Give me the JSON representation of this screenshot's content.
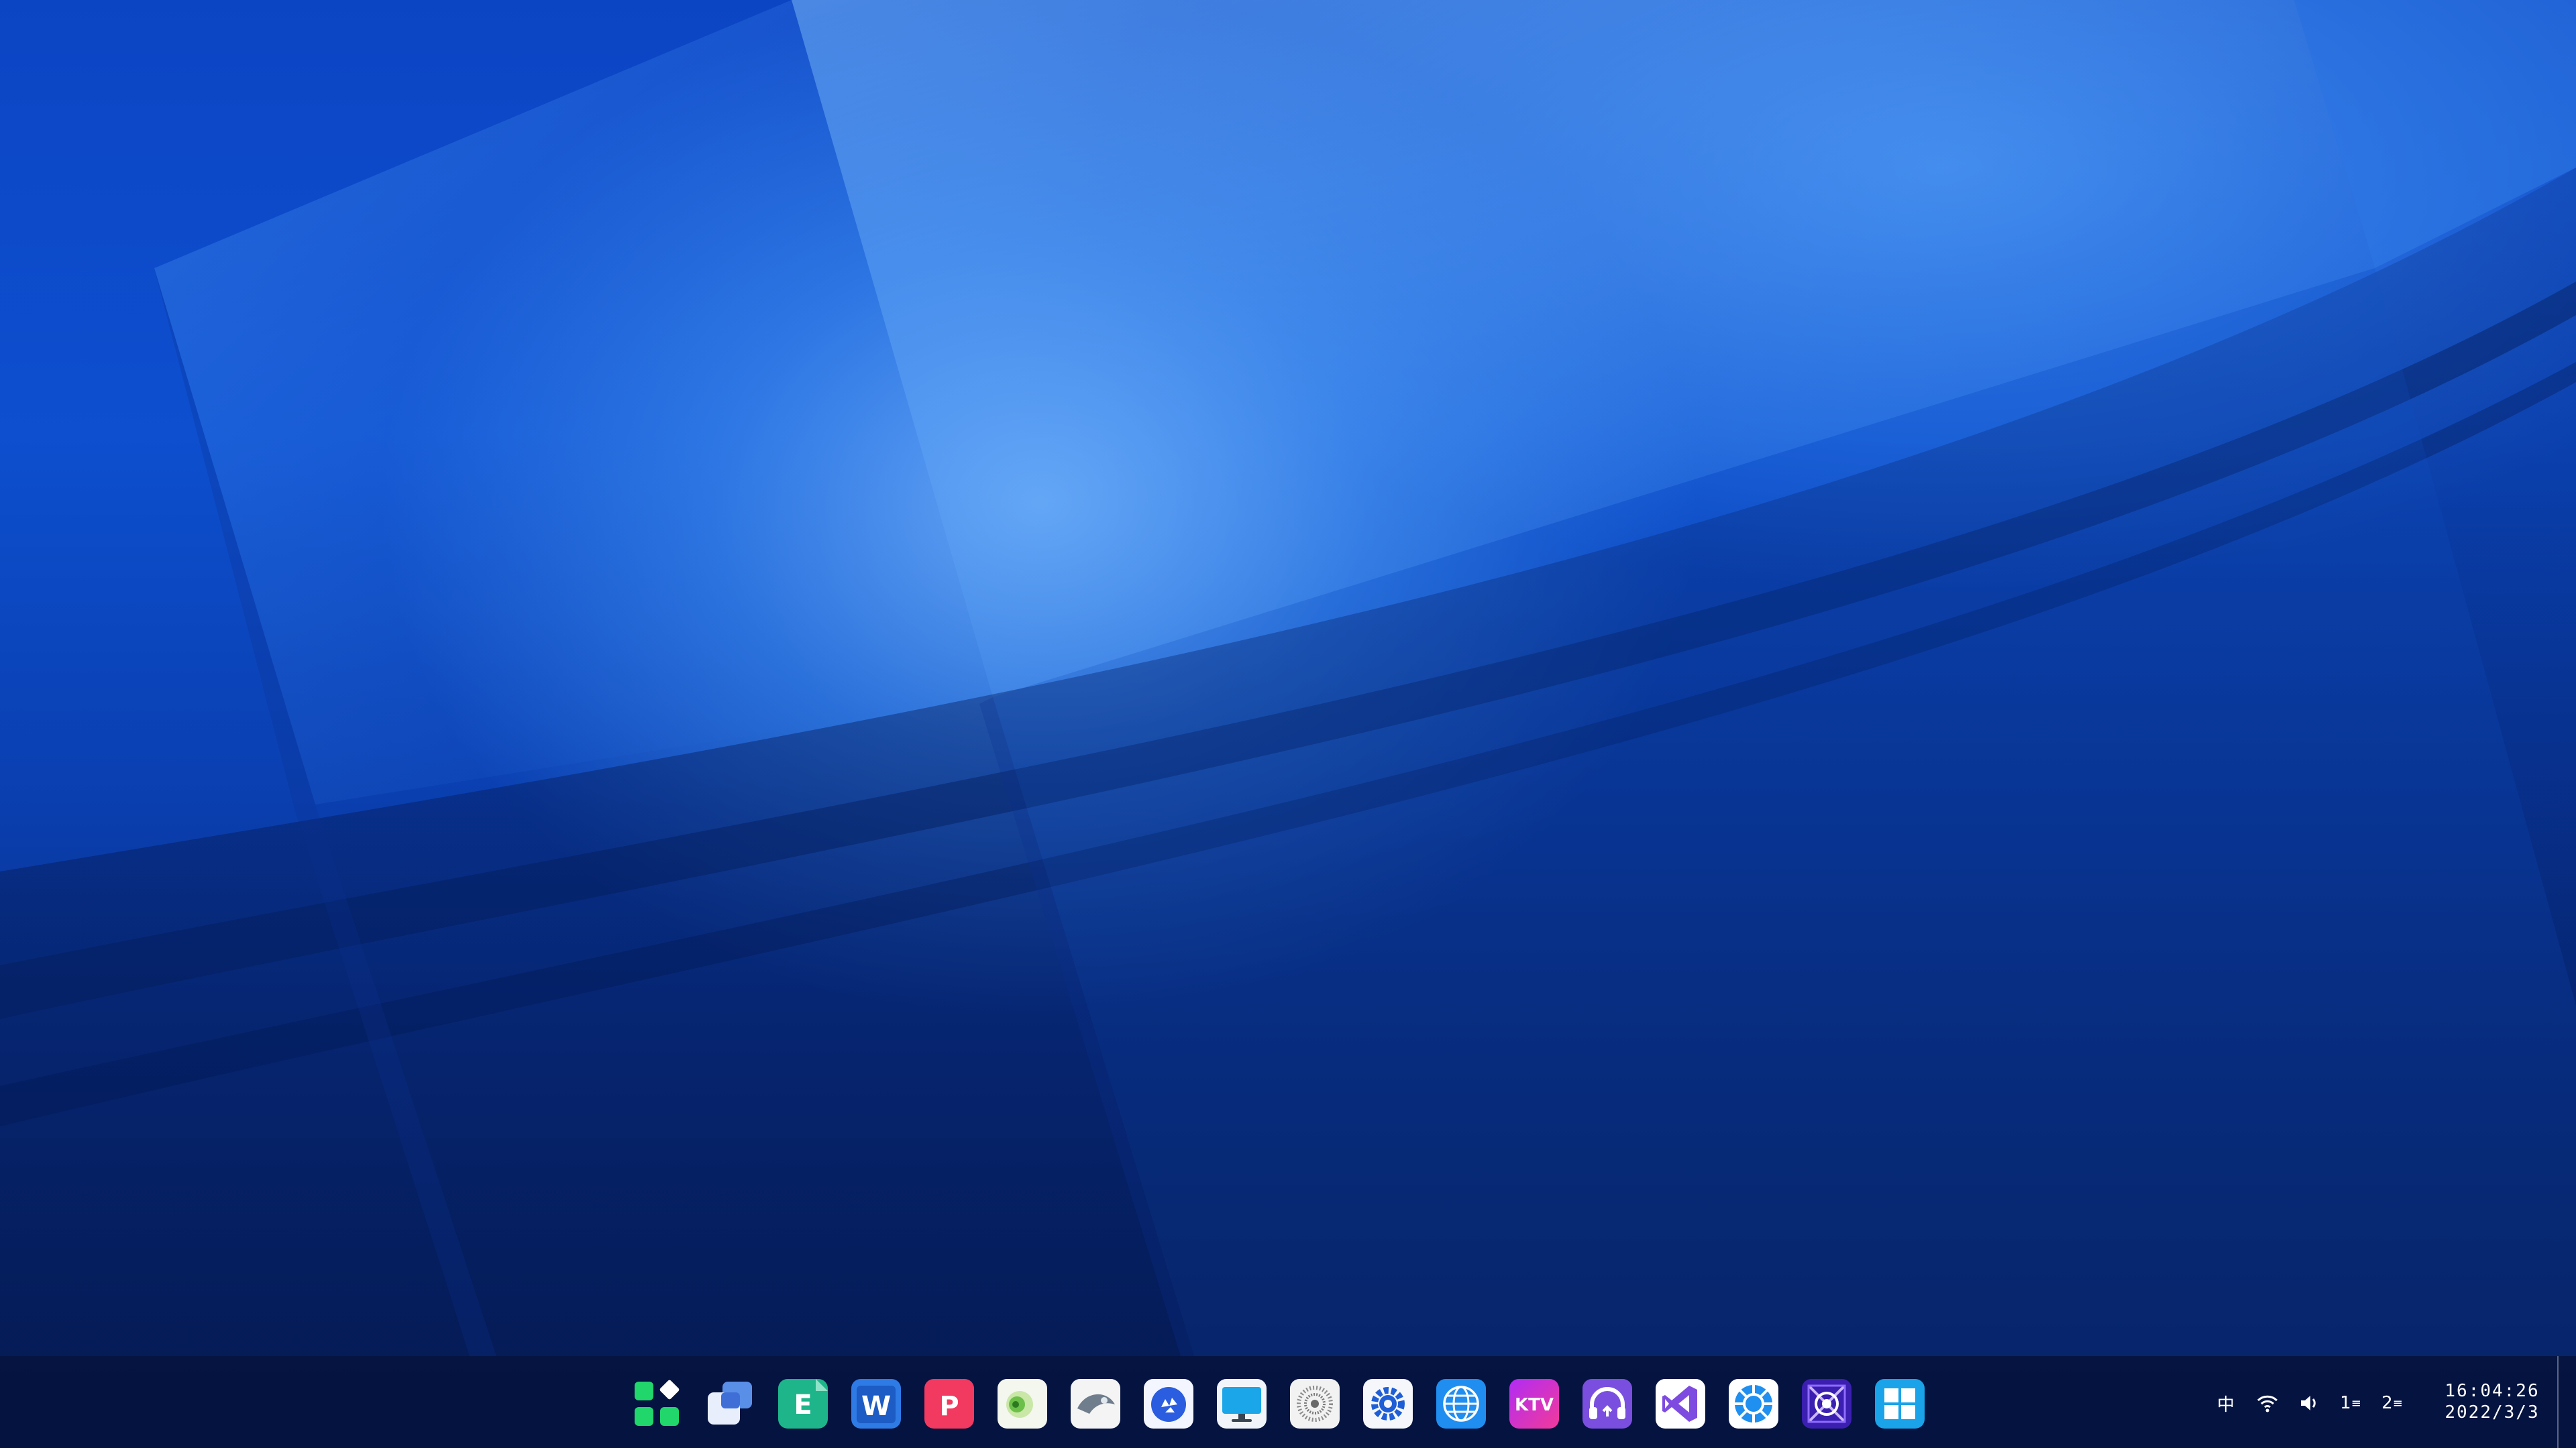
{
  "taskbar": {
    "apps": [
      {
        "name": "launcher",
        "icon": "launcher-icon"
      },
      {
        "name": "multitasking-view",
        "icon": "multitask-icon"
      },
      {
        "name": "spreadsheet",
        "icon": "spreadsheet-icon",
        "label": "E"
      },
      {
        "name": "word-processor",
        "icon": "word-icon",
        "label": "W"
      },
      {
        "name": "presentation",
        "icon": "presentation-icon",
        "label": "P"
      },
      {
        "name": "music-player",
        "icon": "music-icon"
      },
      {
        "name": "image-viewer",
        "icon": "image-viewer-icon"
      },
      {
        "name": "recycle-bin",
        "icon": "recycle-icon"
      },
      {
        "name": "remote-desktop",
        "icon": "monitor-icon"
      },
      {
        "name": "system-monitor",
        "icon": "sunburst-icon"
      },
      {
        "name": "settings",
        "icon": "gear-icon"
      },
      {
        "name": "browser",
        "icon": "globe-icon"
      },
      {
        "name": "ktv",
        "icon": "ktv-icon",
        "label": "KTV"
      },
      {
        "name": "podcast",
        "icon": "headphones-icon"
      },
      {
        "name": "visual-studio",
        "icon": "vs-icon"
      },
      {
        "name": "app-store",
        "icon": "app-store-icon"
      },
      {
        "name": "virtual-machine",
        "icon": "vm-icon"
      },
      {
        "name": "windows-compat",
        "icon": "windows-icon"
      }
    ]
  },
  "tray": {
    "input_method": "中",
    "wifi_icon": "wifi-icon",
    "volume_icon": "speaker-icon",
    "workspace_1": "1",
    "workspace_2": "2"
  },
  "clock": {
    "time": "16:04:26",
    "date": "2022/3/3"
  },
  "colors": {
    "taskbar_bg": "#06123c",
    "wallpaper_base": "#0c45c4",
    "wallpaper_highlight": "#78b9ff"
  }
}
